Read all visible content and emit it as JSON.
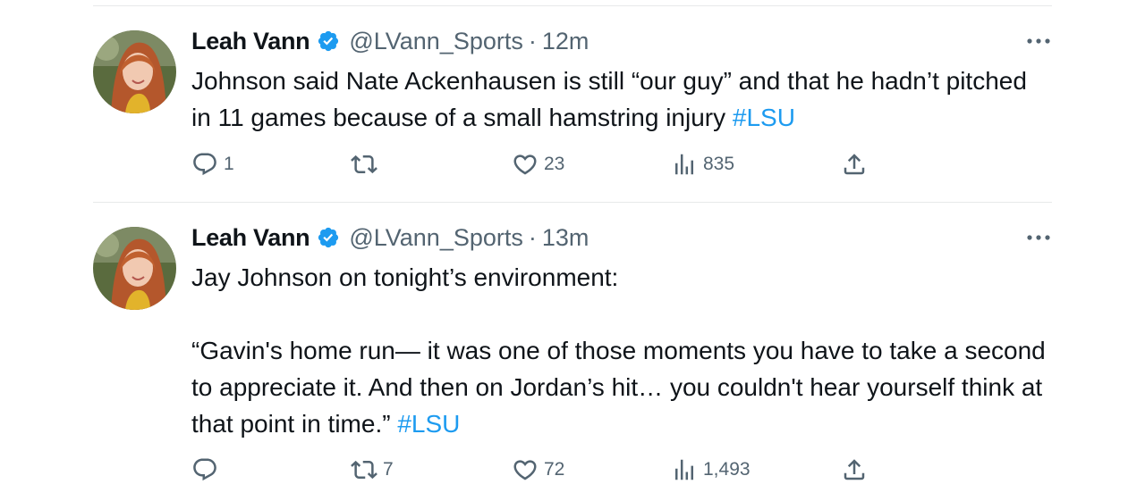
{
  "tweets": [
    {
      "author": {
        "name": "Leah Vann",
        "handle": "@LVann_Sports",
        "verified": true
      },
      "separator": "·",
      "time": "12m",
      "text": "Johnson said Nate Ackenhausen is still “our guy” and that he hadn’t pitched in 11 games because of a small hamstring injury ",
      "hashtag": "#LSU",
      "stats": {
        "replies": "1",
        "retweets": "",
        "likes": "23",
        "views": "835"
      }
    },
    {
      "author": {
        "name": "Leah Vann",
        "handle": "@LVann_Sports",
        "verified": true
      },
      "separator": "·",
      "time": "13m",
      "text": "Jay Johnson on tonight’s environment:\n\n“Gavin's home run— it was one of those moments you have to take a second to appreciate it. And then on Jordan’s hit… you couldn't hear yourself think at that point in time.” ",
      "hashtag": "#LSU",
      "stats": {
        "replies": "",
        "retweets": "7",
        "likes": "72",
        "views": "1,493"
      }
    }
  ],
  "icons": {
    "reply": "reply-icon",
    "retweet": "retweet-icon",
    "like": "heart-icon",
    "views": "views-icon",
    "share": "share-icon",
    "more": "more-icon",
    "verified": "verified-badge-icon"
  },
  "colors": {
    "text": "#0f1419",
    "secondary": "#536471",
    "link": "#1d9bf0",
    "verified": "#1d9bf0",
    "divider": "#e7e9ea"
  }
}
